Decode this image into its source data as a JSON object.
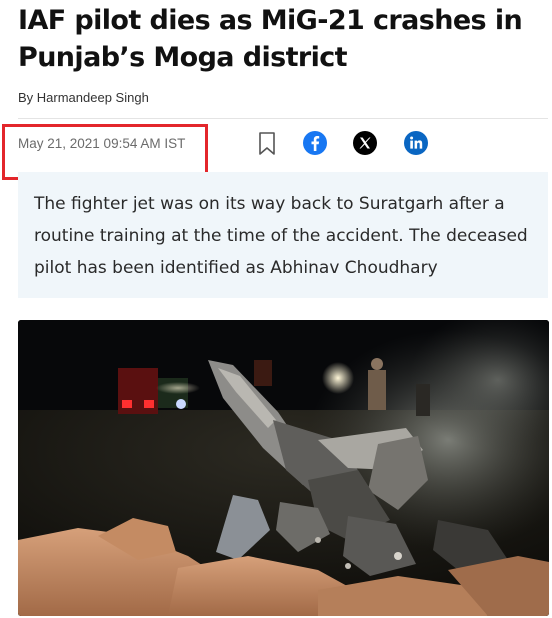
{
  "article": {
    "headline": "IAF pilot dies as MiG-21 crashes in Punjab’s Moga district",
    "byline": "By Harmandeep Singh",
    "timestamp": "May 21, 2021 09:54 AM IST",
    "summary": "The fighter jet was on its way back to Suratgarh after a routine training at the time of the accident. The deceased pilot has been identified as Abhinav Choudhary"
  },
  "share": {
    "icons": [
      "bookmark-icon",
      "facebook-icon",
      "x-icon",
      "linkedin-icon"
    ]
  },
  "colors": {
    "facebook": "#1877f2",
    "x": "#000000",
    "linkedin": "#0a66c2",
    "highlight_border": "#e3262b",
    "summary_background": "#f0f6fa",
    "bookmark": "#555555"
  }
}
